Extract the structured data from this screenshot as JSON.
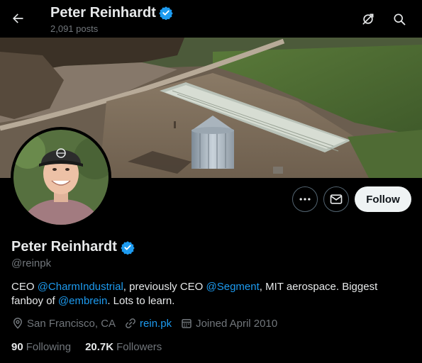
{
  "header": {
    "title": "Peter Reinhardt",
    "post_count": "2,091 posts"
  },
  "icons": {
    "back": "arrow-left-icon",
    "verified": "verified-badge-icon",
    "unsubscribe": "notification-off-icon",
    "search": "search-icon",
    "more": "more-dots-icon",
    "message": "envelope-icon",
    "location": "location-pin-icon",
    "link": "link-icon",
    "calendar": "calendar-icon"
  },
  "profile": {
    "name": "Peter Reinhardt",
    "handle": "@reinpk",
    "follow_label": "Follow",
    "bio": {
      "p1": "CEO ",
      "m1": "@CharmIndustrial",
      "p2": ", previously CEO ",
      "m2": "@Segment",
      "p3": ", MIT aerospace. Biggest fanboy of ",
      "m3": "@embrein",
      "p4": ". Lots to learn."
    },
    "location": "San Francisco, CA",
    "website": "rein.pk",
    "joined": "Joined April 2010",
    "following_count": "90",
    "following_label": "Following",
    "followers_count": "20.7K",
    "followers_label": "Followers"
  },
  "colors": {
    "background": "#000000",
    "accent": "#1d9bf0",
    "text_primary": "#e7e9ea",
    "text_secondary": "#71767b",
    "follow_button": "#eff3f4"
  }
}
